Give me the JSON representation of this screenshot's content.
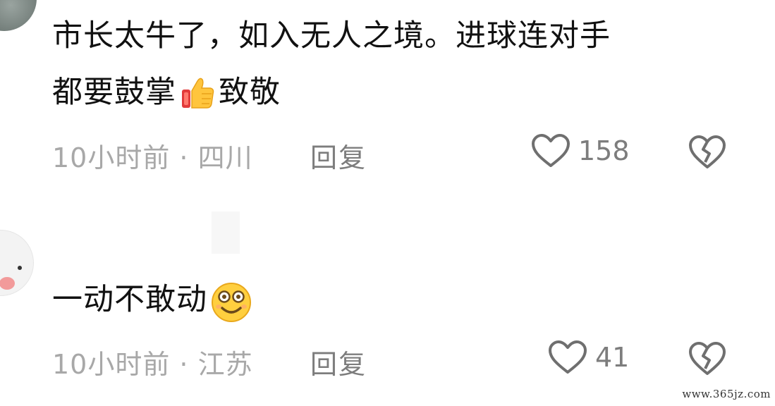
{
  "comments": [
    {
      "text_line1": "市长太牛了，如入无人之境。进球连对手",
      "text_line2_before": "都要鼓掌",
      "emoji": "thumbs-up-icon",
      "text_line2_after": "致敬",
      "meta": "10小时前 · 四川",
      "reply_label": "回复",
      "like_count": "158"
    },
    {
      "text_line1": "一动不敢动",
      "emoji": "smiling-face-icon",
      "meta": "10小时前 · 江苏",
      "reply_label": "回复",
      "like_count": "41"
    }
  ],
  "icons": {
    "like": "heart-outline-icon",
    "dislike": "broken-heart-icon"
  },
  "colors": {
    "text": "#111111",
    "meta": "#a8a8a8",
    "action": "#7d7d7d"
  },
  "watermark": "www.365jz.com"
}
